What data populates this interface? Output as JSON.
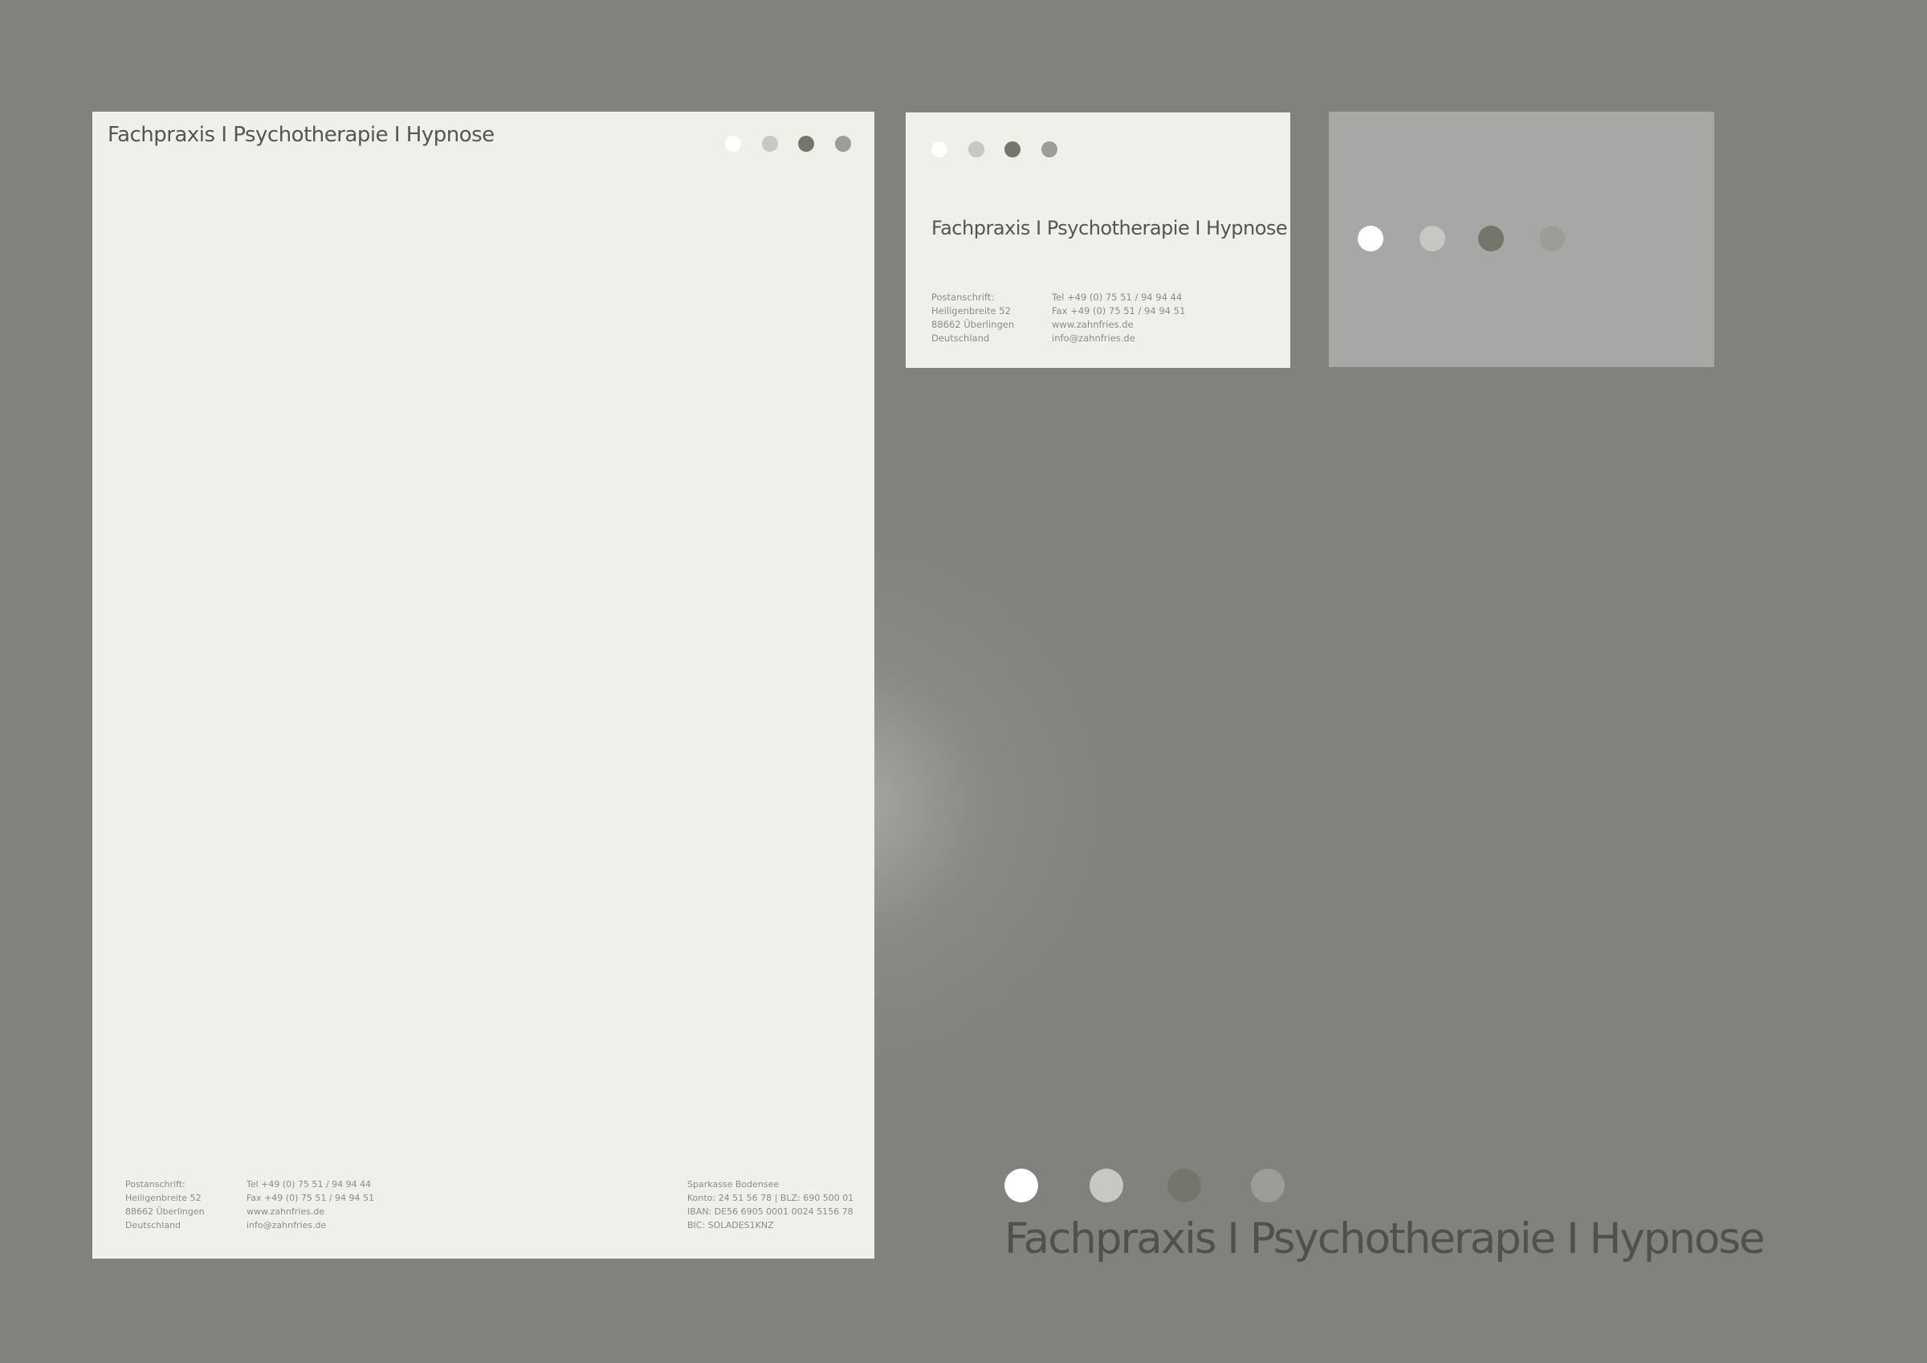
{
  "brand": {
    "name": "Fachpraxis I Psychotherapie I Hypnose"
  },
  "colors": {
    "background": "#81827d",
    "paper": "#f0f0eb",
    "card_back": "#a7a7a5",
    "dot_white": "#ffffff",
    "dot_light": "#c7c7c3",
    "dot_dark": "#75756b",
    "dot_mid": "#9d9d97",
    "text": "#55564f"
  },
  "address": {
    "label": "Postanschrift:",
    "street": "Heiligenbreite 52",
    "city": "88662 Überlingen",
    "country": "Deutschland"
  },
  "contact": {
    "tel": "Tel   +49 (0) 75 51 / 94 94 44",
    "fax": "Fax  +49 (0) 75 51 / 94 94 51",
    "web": "www.zahnfries.de",
    "email": "info@zahnfries.de"
  },
  "bank": {
    "name": "Sparkasse Bodensee",
    "account": "Konto: 24 51 56 78 | BLZ: 690 500 01",
    "iban": "IBAN: DE56 6905 0001 0024 5156 78",
    "bic": "BIC: SOLADES1KNZ"
  }
}
